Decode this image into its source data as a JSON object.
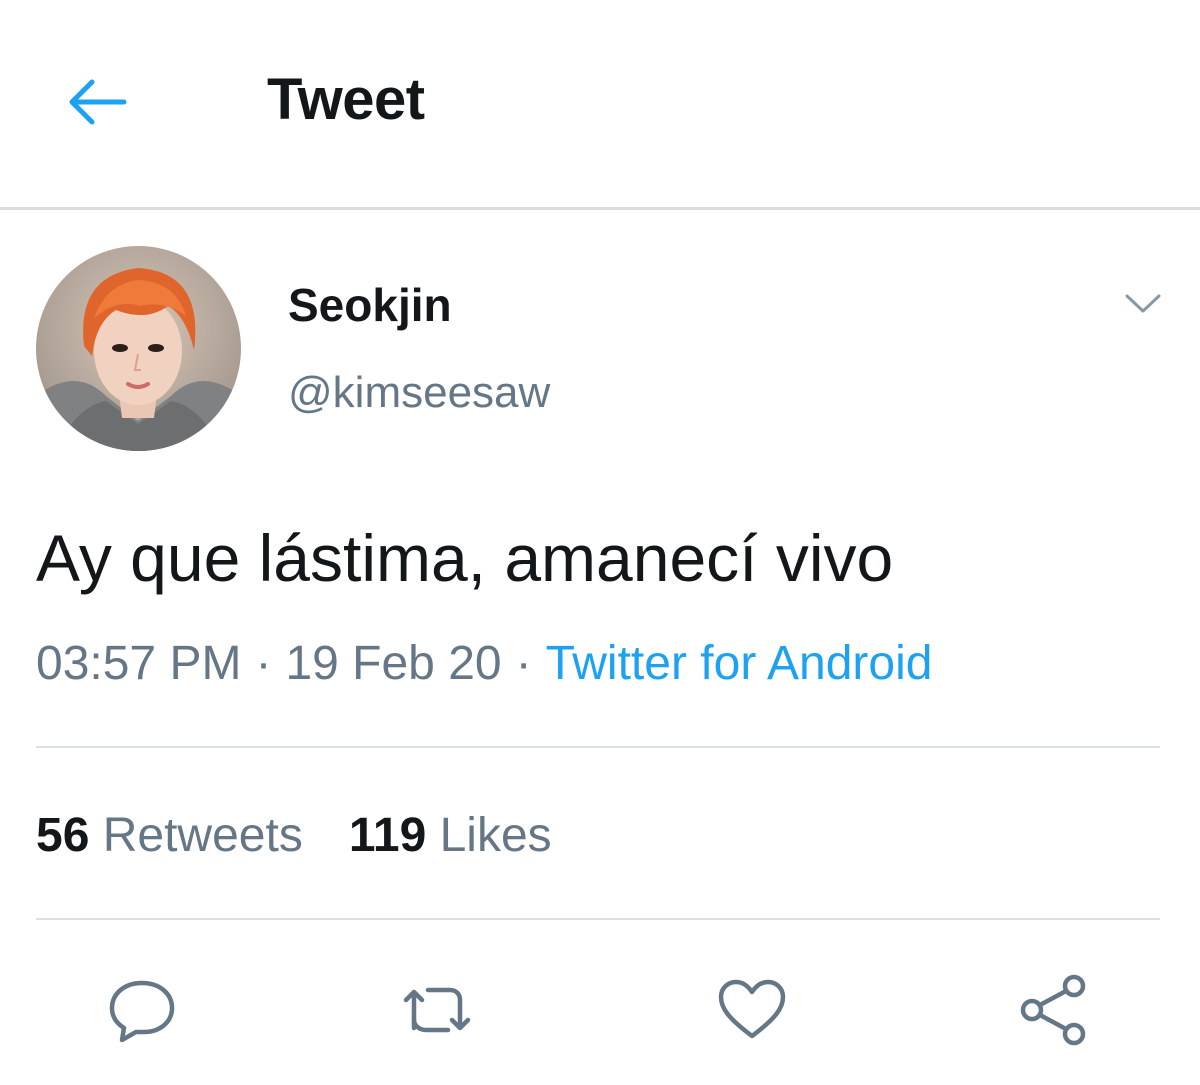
{
  "header": {
    "title": "Tweet",
    "back_icon": "arrow-left-icon"
  },
  "author": {
    "display_name": "Seokjin",
    "handle": "@kimseesaw",
    "avatar_icon": "profile-photo"
  },
  "tweet": {
    "text": "Ay que lástima, amanecí vivo",
    "time": "03:57 PM",
    "date": "19 Feb 20",
    "source": "Twitter for Android",
    "separator": "·"
  },
  "stats": {
    "retweets_count": "56",
    "retweets_label": "Retweets",
    "likes_count": "119",
    "likes_label": "Likes"
  },
  "actions": [
    "reply-icon",
    "retweet-icon",
    "like-icon",
    "share-icon"
  ],
  "colors": {
    "accent": "#1da1f2",
    "text_primary": "#14171a",
    "text_secondary": "#657786",
    "divider": "#dbe0e4"
  }
}
